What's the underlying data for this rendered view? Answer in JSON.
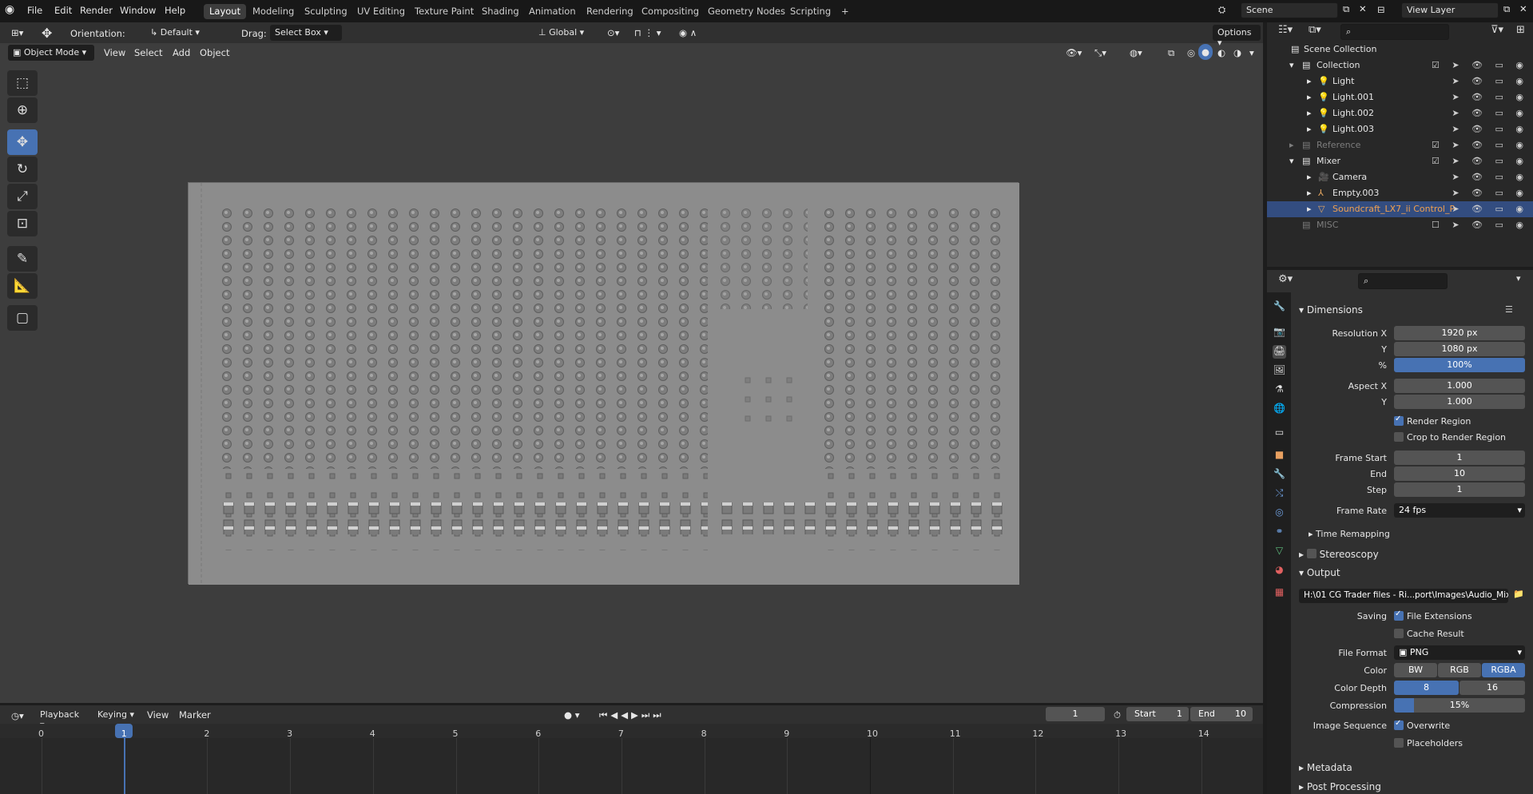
{
  "menubar": {
    "items": [
      "File",
      "Edit",
      "Render",
      "Window",
      "Help"
    ],
    "workspaces": [
      "Layout",
      "Modeling",
      "Sculpting",
      "UV Editing",
      "Texture Paint",
      "Shading",
      "Animation",
      "Rendering",
      "Compositing",
      "Geometry Nodes",
      "Scripting"
    ],
    "active_workspace": "Layout",
    "scene": "Scene",
    "view_layer": "View Layer"
  },
  "viewport_header": {
    "orientation_label": "Orientation:",
    "orientation_value": "Default",
    "drag_label": "Drag:",
    "drag_value": "Select Box",
    "transform_space": "Global",
    "options_label": "Options",
    "mode": "Object Mode",
    "menus": [
      "View",
      "Select",
      "Add",
      "Object"
    ]
  },
  "outliner": {
    "search_placeholder": "",
    "rows": [
      {
        "label": "Scene Collection",
        "type": "scene",
        "indent": 0
      },
      {
        "label": "Collection",
        "type": "collection",
        "indent": 1
      },
      {
        "label": "Light",
        "type": "light",
        "indent": 2
      },
      {
        "label": "Light.001",
        "type": "light",
        "indent": 2
      },
      {
        "label": "Light.002",
        "type": "light",
        "indent": 2
      },
      {
        "label": "Light.003",
        "type": "light",
        "indent": 2
      },
      {
        "label": "Reference",
        "type": "collection",
        "indent": 1,
        "dim": true
      },
      {
        "label": "Mixer",
        "type": "collection",
        "indent": 1
      },
      {
        "label": "Camera",
        "type": "camera",
        "indent": 2
      },
      {
        "label": "Empty.003",
        "type": "empty",
        "indent": 2
      },
      {
        "label": "Soundcraft_LX7_ii Control_P",
        "type": "mesh",
        "indent": 2,
        "selected": true
      },
      {
        "label": "MISC",
        "type": "collection",
        "indent": 1,
        "dim": true
      }
    ]
  },
  "properties": {
    "dimensions": {
      "title": "Dimensions",
      "resolution_x_label": "Resolution X",
      "resolution_x": "1920 px",
      "y_label": "Y",
      "resolution_y": "1080 px",
      "percent_label": "%",
      "percent": "100%",
      "aspect_x_label": "Aspect X",
      "aspect_x": "1.000",
      "aspect_y_label": "Y",
      "aspect_y": "1.000",
      "render_region": "Render Region",
      "crop_region": "Crop to Render Region",
      "frame_start_label": "Frame Start",
      "frame_start": "1",
      "end_label": "End",
      "frame_end": "10",
      "step_label": "Step",
      "frame_step": "1",
      "frame_rate_label": "Frame Rate",
      "frame_rate": "24 fps",
      "time_remapping": "Time Remapping",
      "stereoscopy": "Stereoscopy"
    },
    "output": {
      "title": "Output",
      "path": "H:\\01 CG Trader files - Ri...port\\Images\\Audio_Mixer",
      "saving_label": "Saving",
      "file_extensions": "File Extensions",
      "cache_result": "Cache Result",
      "file_format_label": "File Format",
      "file_format": "PNG",
      "color_label": "Color",
      "color_options": [
        "BW",
        "RGB",
        "RGBA"
      ],
      "color_depth_label": "Color Depth",
      "color_depth_options": [
        "8",
        "16"
      ],
      "compression_label": "Compression",
      "compression": "15%",
      "compression_fraction": 0.15,
      "image_sequence_label": "Image Sequence",
      "overwrite": "Overwrite",
      "placeholders": "Placeholders"
    },
    "metadata": "Metadata",
    "post_processing": "Post Processing"
  },
  "timeline": {
    "menus": [
      "Playback",
      "Keying",
      "View",
      "Marker"
    ],
    "current_frame": "1",
    "start_label": "Start",
    "start": "1",
    "end_label": "End",
    "end": "10",
    "ruler": [
      "0",
      "1",
      "2",
      "3",
      "4",
      "5",
      "6",
      "7",
      "8",
      "9",
      "10",
      "11",
      "12",
      "13",
      "14"
    ]
  },
  "colors": {
    "accent": "#4772b3",
    "selection": "#334d80"
  }
}
